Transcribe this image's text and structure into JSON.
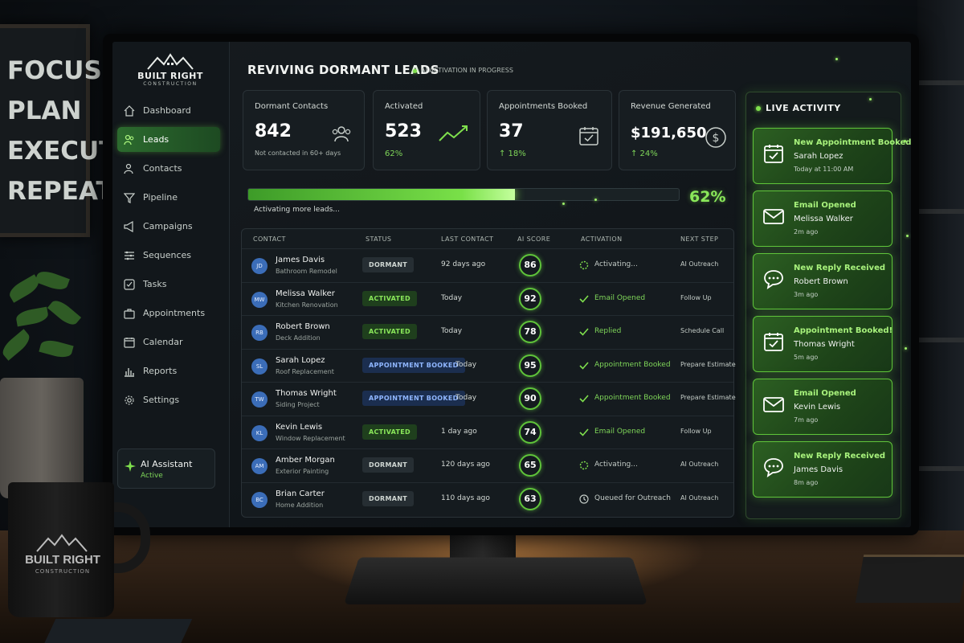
{
  "poster": {
    "lines": [
      "FOCUS",
      "PLAN",
      "EXECUTE",
      "REPEAT"
    ]
  },
  "mug": {
    "brand": "BUILT RIGHT",
    "sub": "CONSTRUCTION"
  },
  "brand": {
    "name": "BUILT RIGHT",
    "sub": "CONSTRUCTION"
  },
  "sidebar": {
    "items": [
      {
        "label": "Dashboard",
        "icon": "home-icon"
      },
      {
        "label": "Leads",
        "icon": "users-icon",
        "active": true
      },
      {
        "label": "Contacts",
        "icon": "contacts-icon"
      },
      {
        "label": "Pipeline",
        "icon": "funnel-icon"
      },
      {
        "label": "Campaigns",
        "icon": "megaphone-icon"
      },
      {
        "label": "Sequences",
        "icon": "sequence-icon"
      },
      {
        "label": "Tasks",
        "icon": "checkbox-icon"
      },
      {
        "label": "Appointments",
        "icon": "briefcase-icon"
      },
      {
        "label": "Calendar",
        "icon": "calendar-icon"
      },
      {
        "label": "Reports",
        "icon": "bar-chart-icon"
      },
      {
        "label": "Settings",
        "icon": "gear-icon"
      }
    ],
    "assistant": {
      "title": "AI Assistant",
      "status": "Active"
    }
  },
  "header": {
    "title": "REVIVING DORMANT LEADS",
    "status": "AI ACTIVATION IN PROGRESS"
  },
  "stats": [
    {
      "label": "Dormant Contacts",
      "value": "842",
      "sub": "Not contacted in 60+ days",
      "icon": "users-icon"
    },
    {
      "label": "Activated",
      "value": "523",
      "sub": "62%",
      "icon": "trend-up-icon"
    },
    {
      "label": "Appointments Booked",
      "value": "37",
      "sub": "↑ 18%",
      "icon": "calendar-check-icon"
    },
    {
      "label": "Revenue Generated",
      "value": "$191,650",
      "sub": "↑ 24%",
      "icon": "dollar-icon"
    }
  ],
  "progress": {
    "value": 0.62,
    "label": "Activating more leads...",
    "percent_text": "62%"
  },
  "table": {
    "headers": [
      "CONTACT",
      "STATUS",
      "LAST CONTACT",
      "AI SCORE",
      "ACTIVATION",
      "NEXT STEP"
    ],
    "rows": [
      {
        "initials": "JD",
        "name": "James Davis",
        "project": "Bathroom Remodel",
        "status": "DORMANT",
        "status_type": "dormant",
        "last": "92 days ago",
        "score": "86",
        "activation": "Activating...",
        "activation_type": "spinner",
        "next": "AI Outreach"
      },
      {
        "initials": "MW",
        "name": "Melissa Walker",
        "project": "Kitchen Renovation",
        "status": "ACTIVATED",
        "status_type": "activated",
        "last": "Today",
        "score": "92",
        "activation": "Email Opened",
        "activation_type": "check",
        "next": "Follow Up"
      },
      {
        "initials": "RB",
        "name": "Robert Brown",
        "project": "Deck Addition",
        "status": "ACTIVATED",
        "status_type": "activated",
        "last": "Today",
        "score": "78",
        "activation": "Replied",
        "activation_type": "check",
        "next": "Schedule Call"
      },
      {
        "initials": "SL",
        "name": "Sarah Lopez",
        "project": "Roof Replacement",
        "status": "APPOINTMENT BOOKED",
        "status_type": "booked",
        "last": "Today",
        "score": "95",
        "activation": "Appointment Booked",
        "activation_type": "check",
        "next": "Prepare Estimate"
      },
      {
        "initials": "TW",
        "name": "Thomas Wright",
        "project": "Siding Project",
        "status": "APPOINTMENT BOOKED",
        "status_type": "booked",
        "last": "Today",
        "score": "90",
        "activation": "Appointment Booked",
        "activation_type": "check",
        "next": "Prepare Estimate"
      },
      {
        "initials": "KL",
        "name": "Kevin Lewis",
        "project": "Window Replacement",
        "status": "ACTIVATED",
        "status_type": "activated",
        "last": "1 day ago",
        "score": "74",
        "activation": "Email Opened",
        "activation_type": "check",
        "next": "Follow Up"
      },
      {
        "initials": "AM",
        "name": "Amber Morgan",
        "project": "Exterior Painting",
        "status": "DORMANT",
        "status_type": "dormant",
        "last": "120 days ago",
        "score": "65",
        "activation": "Activating...",
        "activation_type": "spinner",
        "next": "AI Outreach"
      },
      {
        "initials": "BC",
        "name": "Brian Carter",
        "project": "Home Addition",
        "status": "DORMANT",
        "status_type": "dormant",
        "last": "110 days ago",
        "score": "63",
        "activation": "Queued for Outreach",
        "activation_type": "clock",
        "next": "AI Outreach"
      }
    ]
  },
  "live_activity": {
    "title": "LIVE ACTIVITY",
    "items": [
      {
        "title": "New Appointment Booked!",
        "person": "Sarah Lopez",
        "time": "Today at 11:00 AM",
        "icon": "calendar-check-icon"
      },
      {
        "title": "Email Opened",
        "person": "Melissa Walker",
        "time": "2m ago",
        "icon": "envelope-icon"
      },
      {
        "title": "New Reply Received",
        "person": "Robert Brown",
        "time": "3m ago",
        "icon": "chat-bubble-icon"
      },
      {
        "title": "Appointment Booked!",
        "person": "Thomas Wright",
        "time": "5m ago",
        "icon": "calendar-check-icon"
      },
      {
        "title": "Email Opened",
        "person": "Kevin Lewis",
        "time": "7m ago",
        "icon": "envelope-icon"
      },
      {
        "title": "New Reply Received",
        "person": "James Davis",
        "time": "8m ago",
        "icon": "chat-bubble-icon"
      }
    ]
  },
  "colors": {
    "accent": "#7fe04d",
    "booked": "#8fb6ff",
    "background": "#11161a"
  }
}
